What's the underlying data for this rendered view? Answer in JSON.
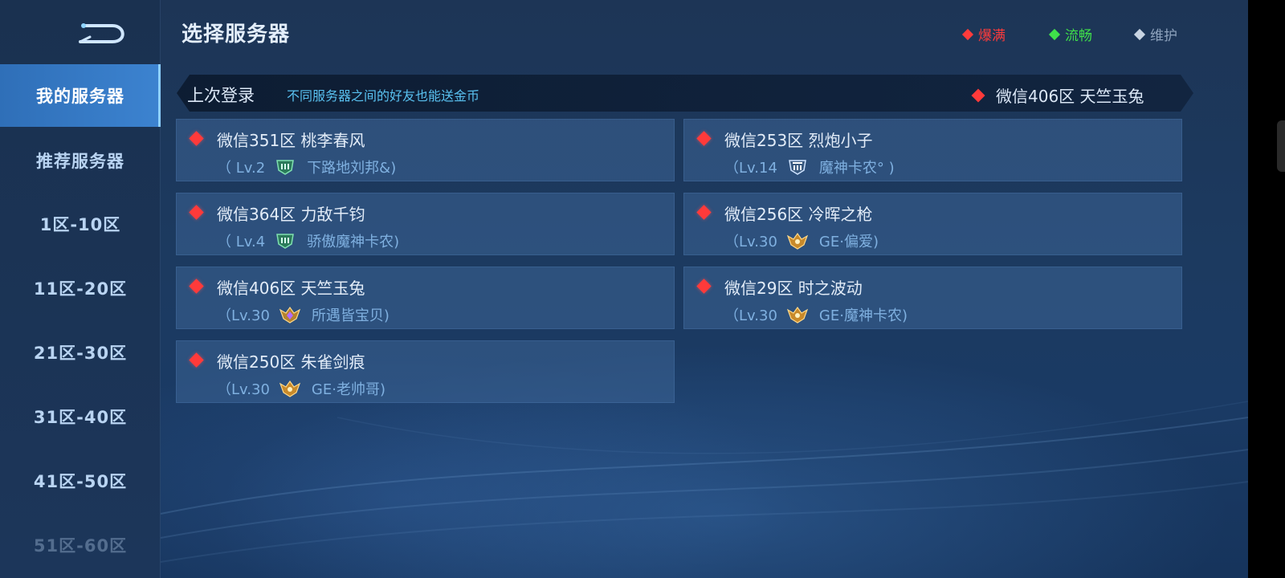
{
  "header": {
    "title": "选择服务器"
  },
  "legend": [
    {
      "label": "爆满",
      "color": "#ff3b3b"
    },
    {
      "label": "流畅",
      "color": "#3fe04a"
    },
    {
      "label": "维护",
      "color": "#c8d4e2"
    }
  ],
  "sidebar": {
    "items": [
      {
        "label": "我的服务器",
        "active": true
      },
      {
        "label": "推荐服务器"
      },
      {
        "label": "1区-10区"
      },
      {
        "label": "11区-20区"
      },
      {
        "label": "21区-30区"
      },
      {
        "label": "31区-40区"
      },
      {
        "label": "41区-50区"
      },
      {
        "label": "51区-60区"
      }
    ]
  },
  "last_login": {
    "label": "上次登录",
    "tip": "不同服务器之间的好友也能送金币",
    "server": "微信406区 天竺玉兔",
    "status_color": "#ff3b3b"
  },
  "servers": [
    {
      "name": "微信351区 桃李春风",
      "level_open": "（ Lv.2",
      "player": "下路地刘邦&)",
      "rank_icon": "bronze-rank-icon"
    },
    {
      "name": "微信253区 烈炮小子",
      "level_open": "（Lv.14",
      "player": "魔神卡农°  )",
      "rank_icon": "silver-rank-icon"
    },
    {
      "name": "微信364区 力敌千钧",
      "level_open": "（ Lv.4",
      "player": "骄傲魔神卡农)",
      "rank_icon": "bronze-rank-icon"
    },
    {
      "name": "微信256区 冷晖之枪",
      "level_open": "（Lv.30",
      "player": "GE·偏爱)",
      "rank_icon": "gold-rank-icon"
    },
    {
      "name": "微信406区 天竺玉兔",
      "level_open": "（Lv.30",
      "player": "所遇皆宝贝)",
      "rank_icon": "diamond-rank-icon"
    },
    {
      "name": "微信29区 时之波动",
      "level_open": "（Lv.30",
      "player": "GE·魔神卡农)",
      "rank_icon": "gold-rank-icon"
    },
    {
      "name": "微信250区 朱雀剑痕",
      "level_open": "（Lv.30",
      "player": "GE·老帅哥)",
      "rank_icon": "gold-rank-icon"
    }
  ]
}
